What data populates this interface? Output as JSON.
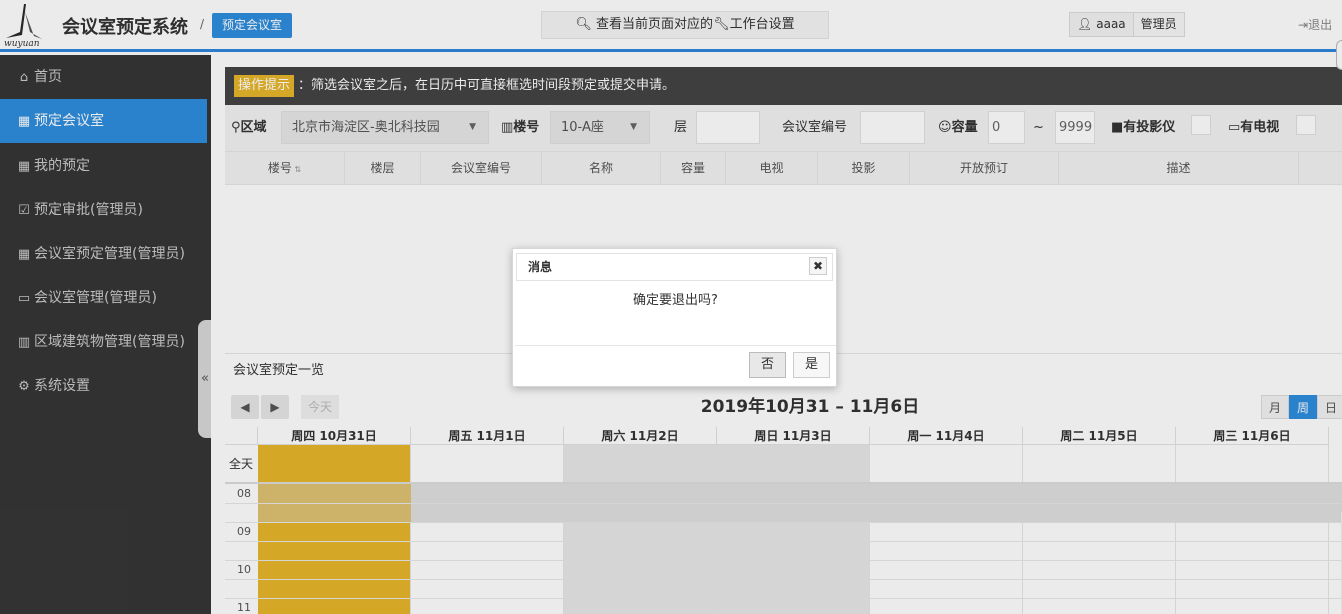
{
  "header": {
    "logo_text": "wuyuan",
    "system_title": "会议室预定系统",
    "crumb_sep": "/",
    "crumb_current": "预定会议室",
    "hint_button": "查看当前页面对应的",
    "hint_button_suffix": "工作台设置",
    "username": "aaaa",
    "role": "管理员",
    "logout": "退出"
  },
  "sidebar": {
    "items": [
      {
        "label": "首页",
        "icon": "home-icon"
      },
      {
        "label": "预定会议室",
        "icon": "calendar-plus-icon",
        "active": true
      },
      {
        "label": "我的预定",
        "icon": "calendar-check-icon"
      },
      {
        "label": "预定审批(管理员)",
        "icon": "check-square-icon"
      },
      {
        "label": "会议室预定管理(管理员)",
        "icon": "calendar-icon"
      },
      {
        "label": "会议室管理(管理员)",
        "icon": "laptop-icon"
      },
      {
        "label": "区域建筑物管理(管理员)",
        "icon": "building-icon"
      },
      {
        "label": "系统设置",
        "icon": "cogs-icon"
      }
    ],
    "collapse_label": "«"
  },
  "tip": {
    "label": "操作提示",
    "text": "：筛选会议室之后，在日历中可直接框选时间段预定或提交申请。"
  },
  "filters": {
    "area_label": "区域",
    "area_value": "北京市海淀区-奥北科技园",
    "building_label": "楼号",
    "building_value": "10-A座",
    "floor_label": "层",
    "floor_value": "",
    "room_no_label": "会议室编号",
    "room_no_value": "",
    "capacity_label": "容量",
    "capacity_min": "0",
    "capacity_sep": "~",
    "capacity_max": "9999",
    "projector_label": "有投影仪",
    "tv_label": "有电视"
  },
  "table": {
    "columns": [
      "楼号",
      "楼层",
      "会议室编号",
      "名称",
      "容量",
      "电视",
      "投影",
      "开放预订",
      "描述"
    ],
    "sort_glyph": "▲▼"
  },
  "overview_title": "会议室预定一览",
  "calendar": {
    "today_button": "今天",
    "title": "2019年10月31 – 11月6日",
    "views": [
      "月",
      "周",
      "日"
    ],
    "active_view": "周",
    "days": [
      "周四 10月31日",
      "周五 11月1日",
      "周六 11月2日",
      "周日 11月3日",
      "周一 11月4日",
      "周二 11月5日",
      "周三 11月6日"
    ],
    "allday_label": "全天",
    "hours": [
      "08",
      "09",
      "10",
      "11"
    ],
    "highlight_color": "#e8b62a"
  },
  "dialog": {
    "title": "消息",
    "message": "确定要退出吗?",
    "no_button": "否",
    "yes_button": "是",
    "close_glyph": "✖"
  }
}
